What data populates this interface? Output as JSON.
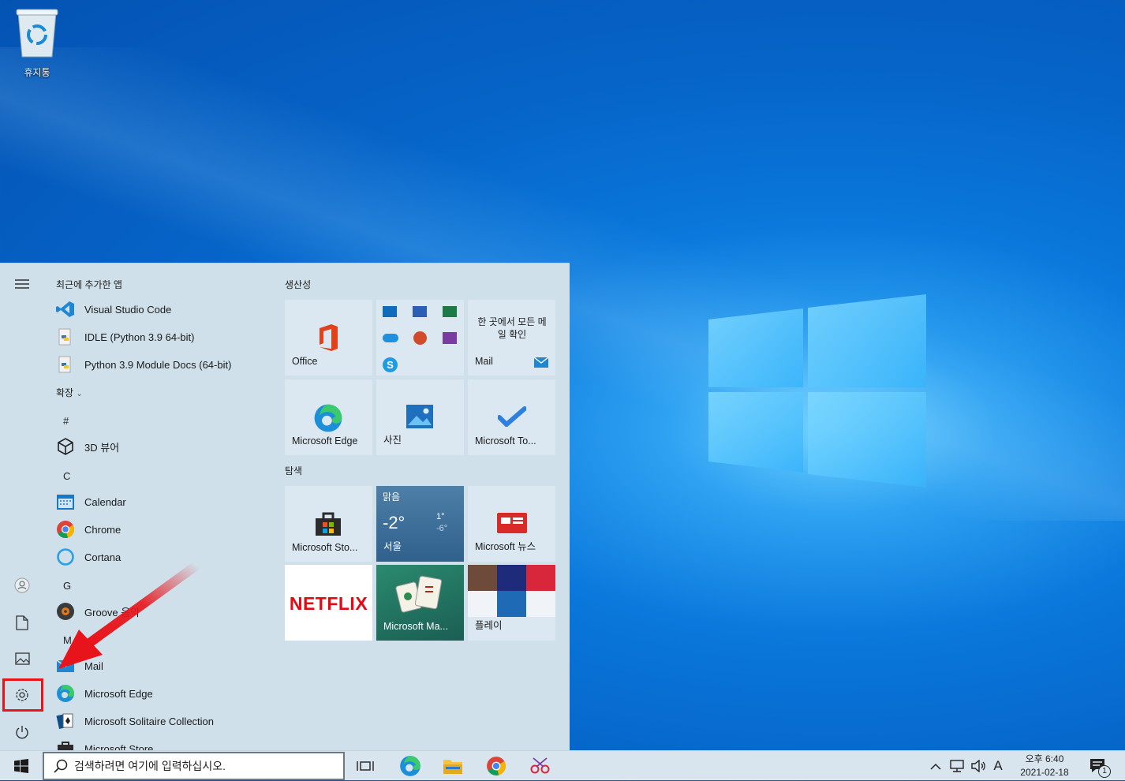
{
  "desktop": {
    "recycle_bin_label": "휴지통"
  },
  "start_menu": {
    "recent_header": "최근에 추가한 앱",
    "recent_apps": [
      {
        "label": "Visual Studio Code",
        "icon": "vscode-icon"
      },
      {
        "label": "IDLE (Python 3.9 64-bit)",
        "icon": "python-icon"
      },
      {
        "label": "Python 3.9 Module Docs (64-bit)",
        "icon": "python-icon"
      }
    ],
    "expand_label": "확장",
    "sections": [
      {
        "letter": "#",
        "apps": [
          {
            "label": "3D 뷰어",
            "icon": "cube-icon"
          }
        ]
      },
      {
        "letter": "C",
        "apps": [
          {
            "label": "Calendar",
            "icon": "calendar-icon"
          },
          {
            "label": "Chrome",
            "icon": "chrome-icon"
          },
          {
            "label": "Cortana",
            "icon": "cortana-icon"
          }
        ]
      },
      {
        "letter": "G",
        "apps": [
          {
            "label": "Groove 음악",
            "icon": "groove-icon"
          }
        ]
      },
      {
        "letter": "M",
        "apps": [
          {
            "label": "Mail",
            "icon": "mail-icon"
          },
          {
            "label": "Microsoft Edge",
            "icon": "edge-icon"
          },
          {
            "label": "Microsoft Solitaire Collection",
            "icon": "solitaire-icon"
          },
          {
            "label": "Microsoft Store",
            "icon": "store-icon"
          }
        ]
      }
    ],
    "tile_groups": [
      {
        "title": "생산성"
      },
      {
        "title": "탐색"
      }
    ],
    "tiles": {
      "office": "Office",
      "mail_caption": "한 곳에서 모든 메일 확인",
      "mail": "Mail",
      "edge": "Microsoft Edge",
      "photos": "사진",
      "todo": "Microsoft To...",
      "store": "Microsoft Sto...",
      "weather_condition": "맑음",
      "weather_temp": "-2°",
      "weather_high": "1°",
      "weather_low": "-6°",
      "weather_city": "서울",
      "news": "Microsoft 뉴스",
      "netflix": "NETFLIX",
      "mahjong": "Microsoft Ma...",
      "play": "플레이"
    }
  },
  "taskbar": {
    "search_placeholder": "검색하려면 여기에 입력하십시오.",
    "ime": "A",
    "time": "오후 6:40",
    "date": "2021-02-18",
    "notification_count": "1"
  },
  "colors": {
    "accent": "#0078d7",
    "highlight_box": "#e8141b",
    "start_bg": "#cfe0ea",
    "taskbar_bg": "#d9e5ee"
  }
}
